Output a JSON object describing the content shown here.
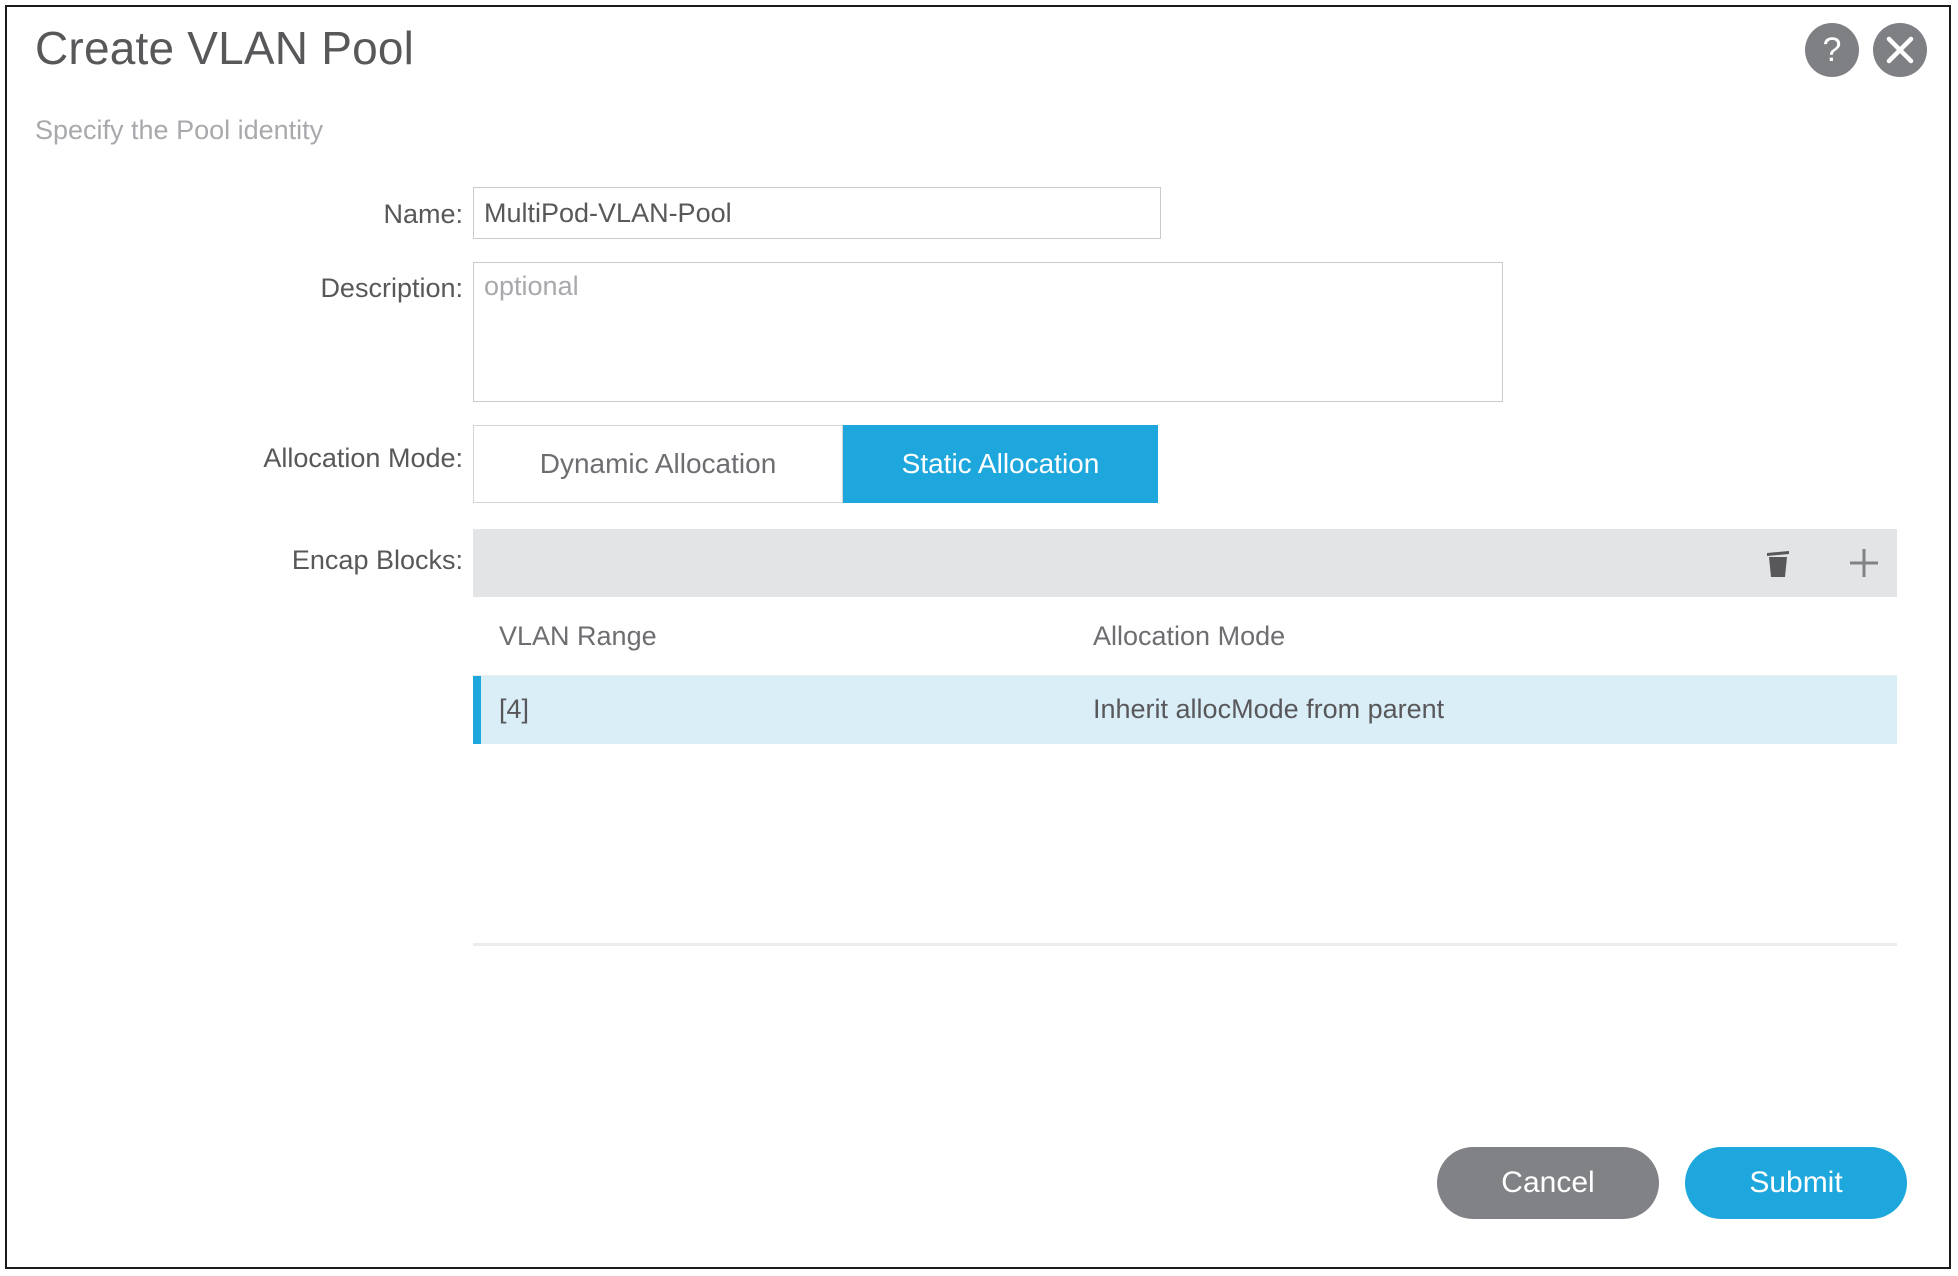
{
  "dialog": {
    "title": "Create VLAN Pool",
    "subtitle": "Specify the Pool identity",
    "help_icon": "help-circle-icon",
    "close_icon": "close-circle-icon",
    "accent_color": "#1ea7dc",
    "selected_row_color": "#daeef8",
    "toolbar_color": "#e3e4e5"
  },
  "form": {
    "name": {
      "label": "Name:",
      "value": "MultiPod-VLAN-Pool",
      "placeholder": ""
    },
    "description": {
      "label": "Description:",
      "value": "",
      "placeholder": "optional"
    },
    "allocation_mode": {
      "label": "Allocation Mode:",
      "options": [
        "Dynamic Allocation",
        "Static Allocation"
      ],
      "selected": "Static Allocation"
    },
    "encap_blocks": {
      "label": "Encap Blocks:",
      "actions": [
        {
          "name": "delete-icon",
          "label": "Delete"
        },
        {
          "name": "add-icon",
          "label": "Add"
        }
      ],
      "columns": [
        "VLAN Range",
        "Allocation Mode"
      ],
      "rows": [
        {
          "vlan_range": "[4]",
          "allocation_mode": "Inherit allocMode from parent",
          "selected": true
        }
      ]
    }
  },
  "footer": {
    "cancel_label": "Cancel",
    "submit_label": "Submit"
  }
}
